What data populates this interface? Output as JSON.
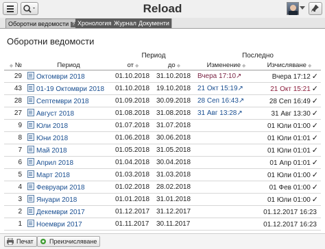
{
  "app": {
    "title": "Reload"
  },
  "tabs": [
    {
      "label": "Оборотни ведомости",
      "help": "?"
    },
    {
      "label": "Хронология"
    },
    {
      "label": "Журнал"
    },
    {
      "label": "Документи"
    }
  ],
  "page": {
    "title": "Оборотни ведомости"
  },
  "table": {
    "headers": {
      "num": "№",
      "period": "Период",
      "period_group": "Период",
      "from": "от",
      "to": "до",
      "last_group": "Последно",
      "changed": "Изменение",
      "calculated": "Изчисляване"
    },
    "rows": [
      {
        "num": "29",
        "period": "Октомври 2018",
        "from": "01.10.2018",
        "to": "31.10.2018",
        "changed": "Вчера 17:10↗",
        "calculated": "Вчера 17:12",
        "check": "✓"
      },
      {
        "num": "43",
        "period": "01-19 Октомври 2018",
        "from": "01.10.2018",
        "to": "19.10.2018",
        "changed": "21 Окт 15:19↗",
        "calculated": "21 Окт 15:21",
        "check": "✓"
      },
      {
        "num": "28",
        "period": "Септември 2018",
        "from": "01.09.2018",
        "to": "30.09.2018",
        "changed": "28 Сеп 16:43↗",
        "calculated": "28 Сеп 16:49",
        "check": "✓"
      },
      {
        "num": "27",
        "period": "Август 2018",
        "from": "01.08.2018",
        "to": "31.08.2018",
        "changed": "31 Авг 13:28↗",
        "calculated": "31 Авг 13:30",
        "check": "✓"
      },
      {
        "num": "9",
        "period": "Юли 2018",
        "from": "01.07.2018",
        "to": "31.07.2018",
        "changed": "",
        "calculated": "01 Юли 01:00",
        "check": "✓"
      },
      {
        "num": "8",
        "period": "Юни 2018",
        "from": "01.06.2018",
        "to": "30.06.2018",
        "changed": "",
        "calculated": "01 Юли 01:01",
        "check": "✓"
      },
      {
        "num": "7",
        "period": "Май 2018",
        "from": "01.05.2018",
        "to": "31.05.2018",
        "changed": "",
        "calculated": "01 Юли 01:01",
        "check": "✓"
      },
      {
        "num": "6",
        "period": "Април 2018",
        "from": "01.04.2018",
        "to": "30.04.2018",
        "changed": "",
        "calculated": "01 Апр 01:01",
        "check": "✓"
      },
      {
        "num": "5",
        "period": "Март 2018",
        "from": "01.03.2018",
        "to": "31.03.2018",
        "changed": "",
        "calculated": "01 Юли 01:00",
        "check": "✓"
      },
      {
        "num": "4",
        "period": "Февруари 2018",
        "from": "01.02.2018",
        "to": "28.02.2018",
        "changed": "",
        "calculated": "01 Фев 01:00",
        "check": "✓"
      },
      {
        "num": "3",
        "period": "Януари 2018",
        "from": "01.01.2018",
        "to": "31.01.2018",
        "changed": "",
        "calculated": "01 Юли 01:00",
        "check": "✓"
      },
      {
        "num": "2",
        "period": "Декември 2017",
        "from": "01.12.2017",
        "to": "31.12.2017",
        "changed": "",
        "calculated": "01.12.2017 16:23",
        "check": ""
      },
      {
        "num": "1",
        "period": "Ноември 2017",
        "from": "01.11.2017",
        "to": "30.11.2017",
        "changed": "",
        "calculated": "01.12.2017 16:23",
        "check": ""
      }
    ]
  },
  "bottom": {
    "print_label": "Печат",
    "recalc_label": "Преизчисляване"
  },
  "colors": {
    "link": "#1a4f91",
    "recent_change": "#7a2545"
  }
}
